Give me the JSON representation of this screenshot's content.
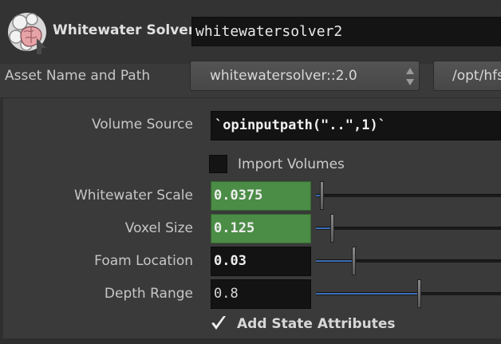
{
  "header": {
    "node_type": "Whitewater Solver",
    "node_name": "whitewatersolver2",
    "icon": "whitewater-solver-icon"
  },
  "asset": {
    "label": "Asset Name and Path",
    "name_value": "whitewatersolver::2.0",
    "path_value": "/opt/hfs"
  },
  "parameters": {
    "volume_source": {
      "label": "Volume Source",
      "value": "`opinputpath(\"..\",1)`"
    },
    "import_volumes": {
      "label": "Import Volumes",
      "checked": false
    },
    "whitewater_scale": {
      "label": "Whitewater Scale",
      "value": "0.0375",
      "slider_fraction": 0.02
    },
    "voxel_size": {
      "label": "Voxel Size",
      "value": "0.125",
      "slider_fraction": 0.08
    },
    "foam_location": {
      "label": "Foam Location",
      "value": "0.03",
      "slider_fraction": 0.2
    },
    "depth_range": {
      "label": "Depth Range",
      "value": "0.8",
      "slider_fraction": 0.56
    },
    "add_state_attributes": {
      "label": "Add State Attributes",
      "checked": true
    }
  },
  "colors": {
    "modified_field": "#4b8c46",
    "slider_fill": "#3b6fb8"
  }
}
